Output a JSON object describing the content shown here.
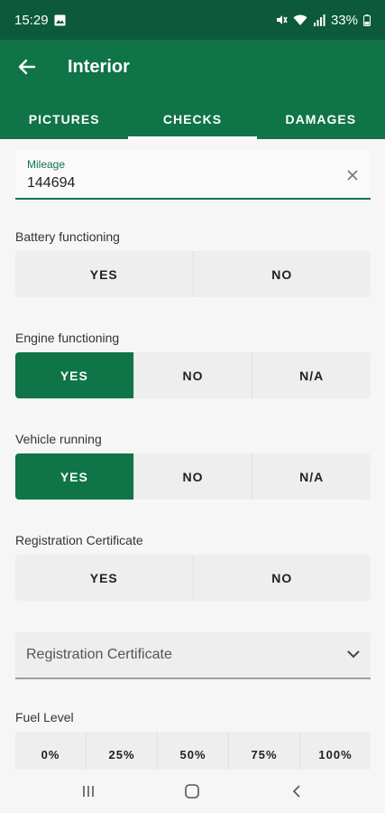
{
  "status": {
    "time": "15:29",
    "battery": "33%"
  },
  "appbar": {
    "title": "Interior"
  },
  "tabs": [
    {
      "label": "PICTURES"
    },
    {
      "label": "CHECKS"
    },
    {
      "label": "DAMAGES"
    }
  ],
  "mileage": {
    "label": "Mileage",
    "value": "144694"
  },
  "battery": {
    "label": "Battery functioning",
    "options": [
      "YES",
      "NO"
    ]
  },
  "engine": {
    "label": "Engine functioning",
    "options": [
      "YES",
      "NO",
      "N/A"
    ],
    "selected": "YES"
  },
  "running": {
    "label": "Vehicle running",
    "options": [
      "YES",
      "NO",
      "N/A"
    ],
    "selected": "YES"
  },
  "registration": {
    "label": "Registration Certificate",
    "options": [
      "YES",
      "NO"
    ]
  },
  "registration_dropdown": {
    "placeholder": "Registration Certificate"
  },
  "fuel": {
    "label": "Fuel Level",
    "options": [
      "0%",
      "25%",
      "50%",
      "75%",
      "100%"
    ]
  },
  "colors": {
    "primary": "#0f7448",
    "statusbar": "#0c5a3b",
    "segment_bg": "#eeeeee"
  },
  "icons": [
    "back-arrow-icon",
    "clear-icon",
    "chevron-down-icon",
    "recents-icon",
    "home-icon",
    "back-nav-icon"
  ]
}
